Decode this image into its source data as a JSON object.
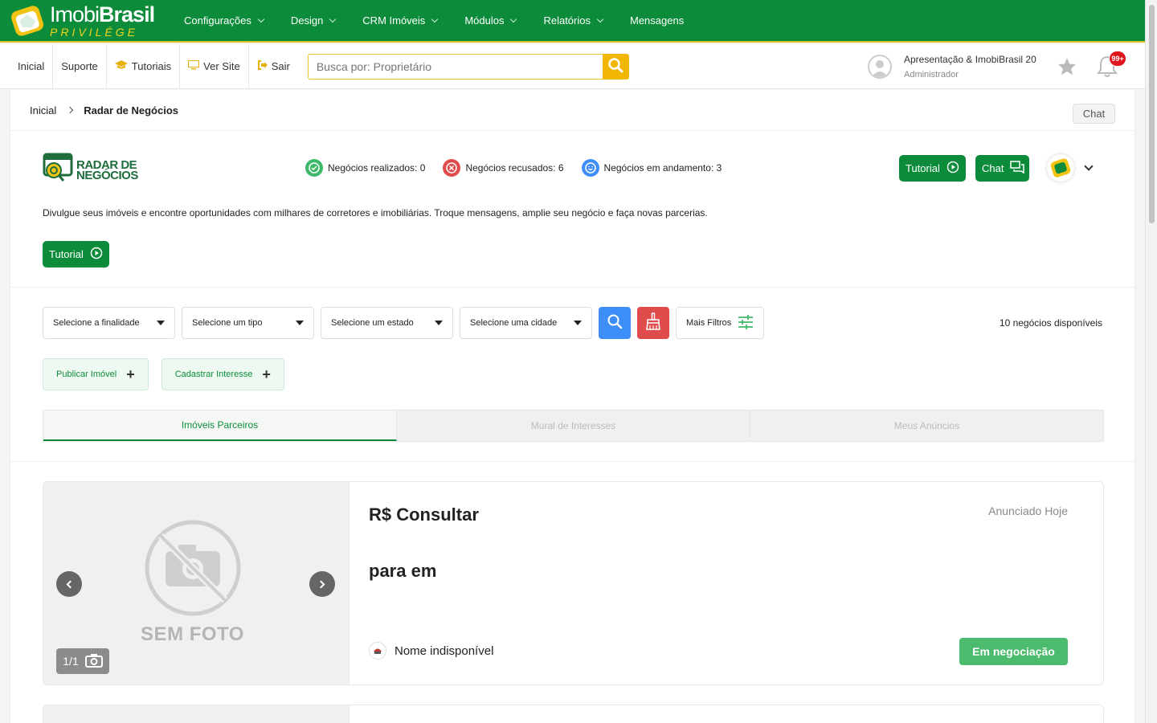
{
  "brand": {
    "name_light": "Imobi",
    "name_bold": "Brasil",
    "tagline": "PRIVILÉGE"
  },
  "nav": [
    {
      "label": "Configurações",
      "has_dropdown": true
    },
    {
      "label": "Design",
      "has_dropdown": true
    },
    {
      "label": "CRM Imóveis",
      "has_dropdown": true
    },
    {
      "label": "Módulos",
      "has_dropdown": true
    },
    {
      "label": "Relatórios",
      "has_dropdown": true
    },
    {
      "label": "Mensagens",
      "has_dropdown": false
    }
  ],
  "subbar": {
    "links": [
      {
        "label": "Inicial",
        "icon": ""
      },
      {
        "label": "Suporte",
        "icon": ""
      },
      {
        "label": "Tutoriais",
        "icon": "graduation-cap-icon"
      },
      {
        "label": "Ver Site",
        "icon": "monitor-icon"
      },
      {
        "label": "Sair",
        "icon": "sign-out-icon"
      }
    ],
    "search_placeholder": "Busca por: Proprietário",
    "user_name": "Apresentação & ImobiBrasil 20",
    "user_role": "Administrador",
    "notifications": "99+"
  },
  "breadcrumb": {
    "home": "Inicial",
    "current": "Radar de Negócios"
  },
  "chat_top": "Chat",
  "radar": {
    "logo_line1": "RADAR DE",
    "logo_line2": "NEGÓCIOS",
    "stats": [
      {
        "label": "Negócios realizados:",
        "value": "0",
        "color": "#3fb86a",
        "icon": "check-circle-icon"
      },
      {
        "label": "Negócios recusados:",
        "value": "6",
        "color": "#e04b4b",
        "icon": "x-circle-icon"
      },
      {
        "label": "Negócios em andamento:",
        "value": "3",
        "color": "#3d8ef8",
        "icon": "smile-circle-icon"
      }
    ],
    "tutorial_label": "Tutorial",
    "chat_label": "Chat",
    "description": "Divulgue seus imóveis e encontre oportunidades com milhares de corretores e imobiliárias. Troque mensagens, amplie seu negócio e faça novas parcerias.",
    "tutorial2_label": "Tutorial"
  },
  "filters": {
    "selects": [
      "Selecione a finalidade",
      "Selecione um tipo",
      "Selecione um estado",
      "Selecione uma cidade"
    ],
    "more_label": "Mais Filtros",
    "available": "10 negócios disponíveis"
  },
  "actions": {
    "publish": "Publicar Imóvel",
    "interest": "Cadastrar Interesse"
  },
  "tabs": [
    {
      "label": "Imóveis Parceiros",
      "active": true
    },
    {
      "label": "Mural de Interesses",
      "active": false
    },
    {
      "label": "Meus Anúncios",
      "active": false
    }
  ],
  "listing": {
    "photo_text": "SEM FOTO",
    "counter": "1/1",
    "price": "R$ Consultar",
    "posted": "Anunciado Hoje",
    "headline": "para em",
    "owner": "Nome indisponível",
    "status": "Em negociação"
  },
  "colors": {
    "primary": "#0c8c3a",
    "accent": "#f2b705",
    "danger": "#e04b4b",
    "info": "#3d8ef8"
  }
}
